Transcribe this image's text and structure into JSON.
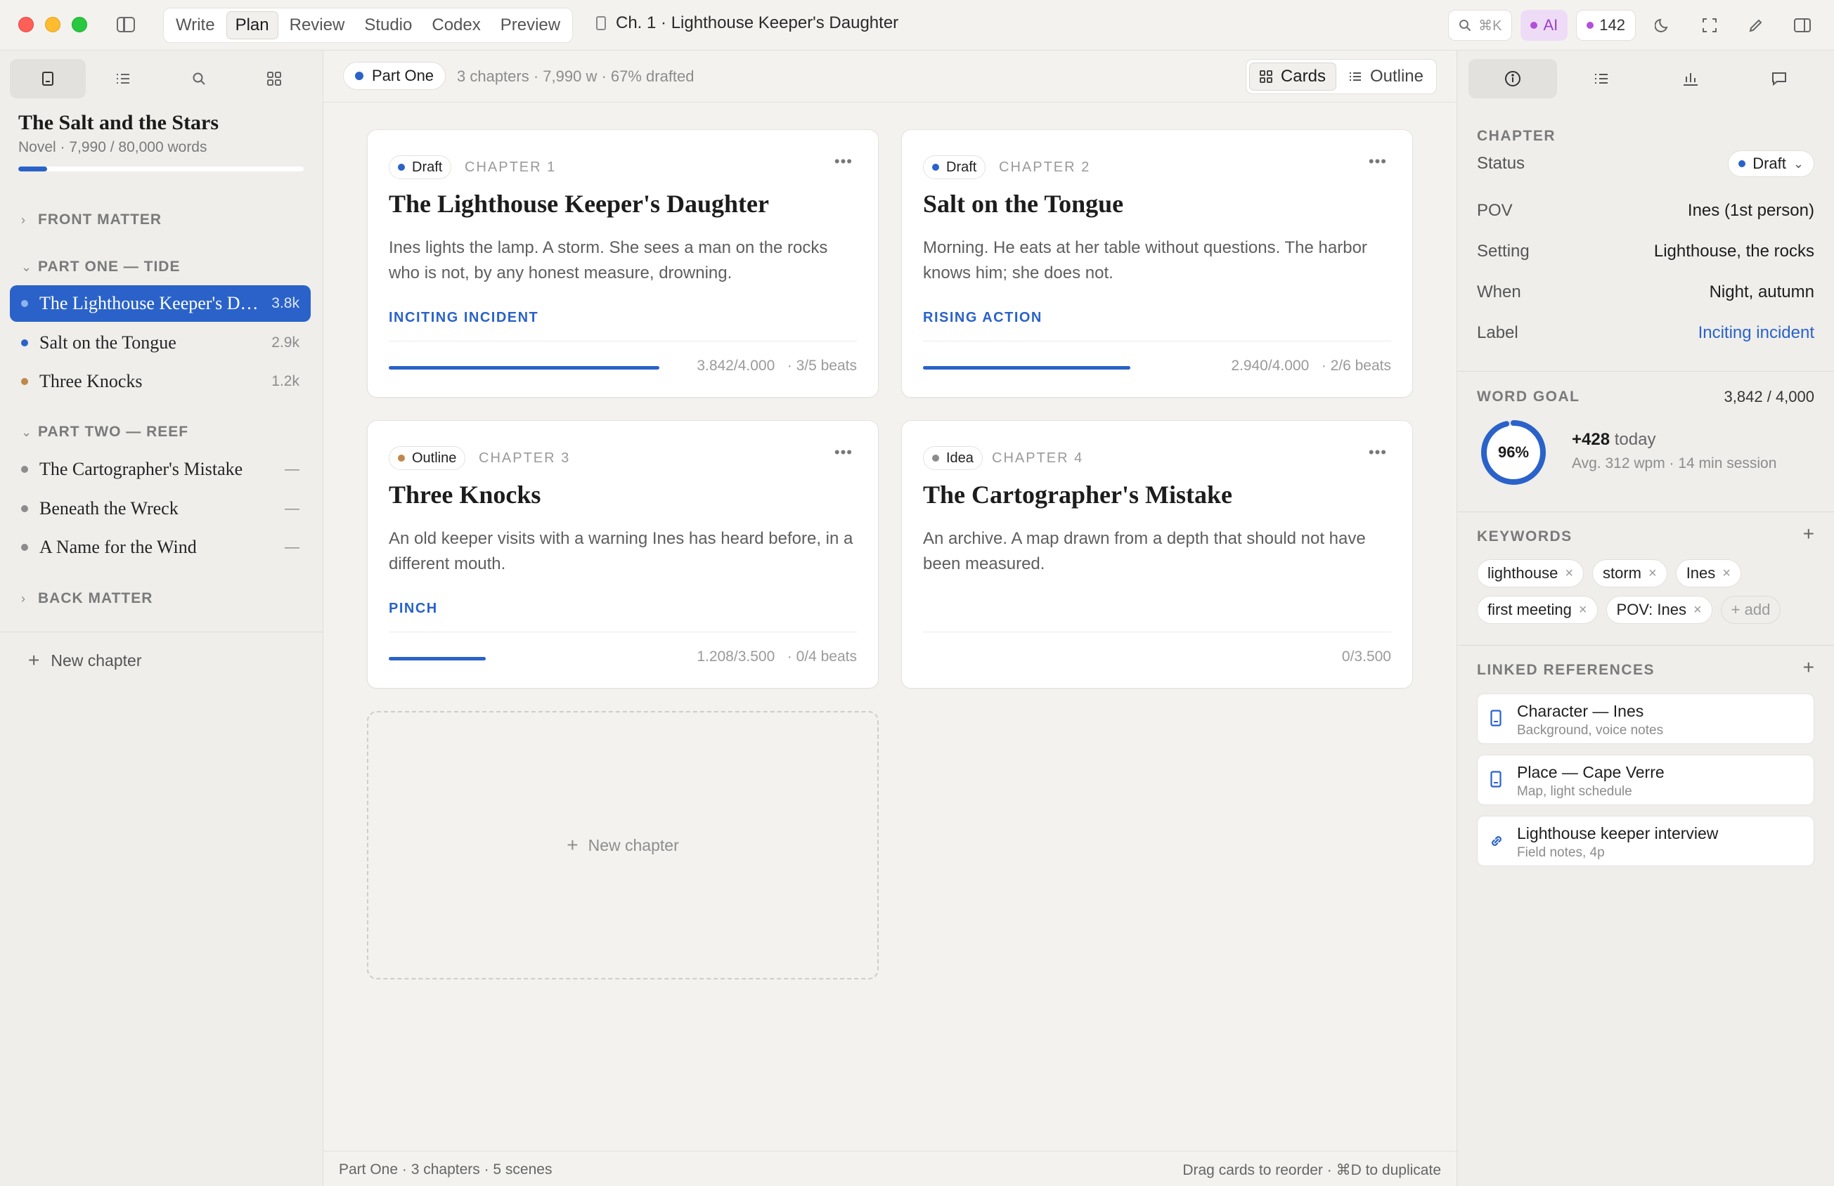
{
  "titlebar": {
    "modes": [
      "Write",
      "Plan",
      "Review",
      "Studio",
      "Codex",
      "Preview"
    ],
    "active_mode": "Plan",
    "doc_title": "Ch. 1 · Lighthouse Keeper's Daughter",
    "search_shortcut": "⌘K",
    "ai_label": "AI",
    "count": "142",
    "colors": {
      "ai_bg": "#eedcf7",
      "ai_fg": "#9a40c8",
      "count_dot": "#b34fd8"
    }
  },
  "left": {
    "tabs": [
      "manuscript-icon",
      "outline-list-icon",
      "search-icon",
      "grid-icon"
    ],
    "book_title": "The Salt and the Stars",
    "book_meta": "Novel · 7,990 / 80,000 words",
    "book_progress": 0.0999,
    "sections": {
      "front": "FRONT MATTER",
      "part_one": "PART ONE — TIDE",
      "part_two": "PART TWO — REEF",
      "back": "BACK MATTER"
    },
    "part_one_items": [
      {
        "label": "The Lighthouse Keeper's Daughter",
        "count": "3.8k",
        "color": "#2a62c9",
        "active": true
      },
      {
        "label": "Salt on the Tongue",
        "count": "2.9k",
        "color": "#2a62c9"
      },
      {
        "label": "Three Knocks",
        "count": "1.2k",
        "color": "#c0884a"
      }
    ],
    "part_two_items": [
      {
        "label": "The Cartographer's Mistake",
        "count": "—",
        "color": "#8c8c8c"
      },
      {
        "label": "Beneath the Wreck",
        "count": "—",
        "color": "#8c8c8c"
      },
      {
        "label": "A Name for the Wind",
        "count": "—",
        "color": "#8c8c8c"
      }
    ],
    "new_chapter": "New chapter"
  },
  "main": {
    "part_label": "Part One",
    "stats": "3 chapters · 7,990 w · 67% drafted",
    "views": [
      "Cards",
      "Outline"
    ],
    "active_view": "Cards",
    "cards": [
      {
        "status": "Draft",
        "status_color": "#2a62c9",
        "chapter": "CHAPTER 1",
        "title": "The Lighthouse Keeper's Daughter",
        "summary": "Ines lights the lamp. A storm. She sees a man on the rocks who is not, by any honest measure, drowning.",
        "tag": "INCITING INCIDENT",
        "words": "3.842/4.000",
        "beats": "· 3/5 beats",
        "progress": 0.9605
      },
      {
        "status": "Draft",
        "status_color": "#2a62c9",
        "chapter": "CHAPTER 2",
        "title": "Salt on the Tongue",
        "summary": "Morning. He eats at her table without questions. The harbor knows him; she does not.",
        "tag": "RISING ACTION",
        "words": "2.940/4.000",
        "beats": "· 2/6 beats",
        "progress": 0.735
      },
      {
        "status": "Outline",
        "status_color": "#c0884a",
        "chapter": "CHAPTER 3",
        "title": "Three Knocks",
        "summary": "An old keeper visits with a warning Ines has heard before, in a different mouth.",
        "tag": "PINCH",
        "words": "1.208/3.500",
        "beats": "· 0/4 beats",
        "progress": 0.345
      },
      {
        "status": "Idea",
        "status_color": "#8c8c8c",
        "chapter": "CHAPTER 4",
        "title": "The Cartographer's Mistake",
        "summary": "An archive. A map drawn from a depth that should not have been measured.",
        "tag": "",
        "words": "0/3.500",
        "beats": "",
        "progress": 0
      }
    ],
    "new_chapter": "New chapter",
    "footer_left": "Part One · 3 chapters · 5 scenes",
    "footer_right": "Drag cards to reorder · ⌘D to duplicate"
  },
  "inspector": {
    "tabs": [
      "info-icon",
      "list-icon",
      "chart-icon",
      "comment-icon"
    ],
    "chapter_section": "CHAPTER",
    "fields": {
      "status_k": "Status",
      "status_v": "Draft",
      "pov_k": "POV",
      "pov_v": "Ines (1st person)",
      "setting_k": "Setting",
      "setting_v": "Lighthouse, the rocks",
      "when_k": "When",
      "when_v": "Night, autumn",
      "label_k": "Label",
      "label_v": "Inciting incident"
    },
    "word_goal": {
      "title": "WORD GOAL",
      "value": "3,842 / 4,000",
      "percent": "96%",
      "fraction": 0.96,
      "today_num": "+428",
      "today_word": "today",
      "avg": "Avg. 312 wpm · 14 min session"
    },
    "keywords_title": "KEYWORDS",
    "keywords": [
      "lighthouse",
      "storm",
      "Ines",
      "first meeting",
      "POV: Ines"
    ],
    "keyword_add": "+ add",
    "refs_title": "LINKED REFERENCES",
    "refs": [
      {
        "title": "Character — Ines",
        "sub": "Background, voice notes",
        "icon": "document-icon"
      },
      {
        "title": "Place — Cape Verre",
        "sub": "Map, light schedule",
        "icon": "document-icon"
      },
      {
        "title": "Lighthouse keeper interview",
        "sub": "Field notes, 4p",
        "icon": "link-icon"
      }
    ]
  }
}
